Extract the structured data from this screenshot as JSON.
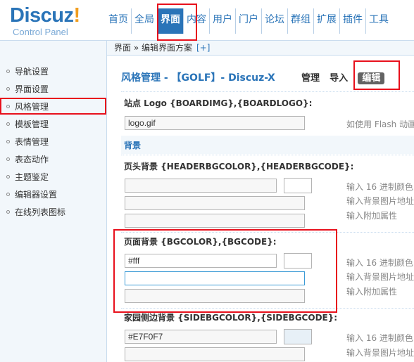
{
  "logo": {
    "main": "Discuz",
    "bang": "!",
    "sub": "Control Panel"
  },
  "nav": [
    {
      "label": "首页"
    },
    {
      "label": "全局"
    },
    {
      "label": "界面",
      "active": true
    },
    {
      "label": "内容"
    },
    {
      "label": "用户"
    },
    {
      "label": "门户"
    },
    {
      "label": "论坛"
    },
    {
      "label": "群组"
    },
    {
      "label": "扩展"
    },
    {
      "label": "插件"
    },
    {
      "label": "工具"
    }
  ],
  "breadcrumb": {
    "text": "界面 » 编辑界面方案",
    "plus": "[+]"
  },
  "sidebar": [
    {
      "label": "导航设置"
    },
    {
      "label": "界面设置"
    },
    {
      "label": "风格管理",
      "active": true
    },
    {
      "label": "模板管理"
    },
    {
      "label": "表情管理"
    },
    {
      "label": "表态动作"
    },
    {
      "label": "主题鉴定"
    },
    {
      "label": "编辑器设置"
    },
    {
      "label": "在线列表图标"
    }
  ],
  "main": {
    "title": "风格管理 - 【GOLF】- Discuz-X",
    "actions": [
      {
        "label": "管理"
      },
      {
        "label": "导入"
      },
      {
        "label": "编辑",
        "active": true
      }
    ],
    "logo_label": "站点 Logo {BOARDIMG},{BOARDLOGO}:",
    "logo_value": "logo.gif",
    "logo_hint": "如使用 Flash 动画",
    "section_bg": "背景",
    "header_bg_label": "页头背景 {HEADERBGCOLOR},{HEADERBGCODE}:",
    "page_bg_label": "页面背景 {BGCOLOR},{BGCODE}:",
    "page_bg_value": "#fff",
    "side_bg_label": "家园侧边背景 {SIDEBGCOLOR},{SIDEBGCODE}:",
    "side_bg_value": "#E7F0F7",
    "hint_color": "输入 16 进制颜色",
    "hint_image": "输入背景图片地址",
    "hint_extra": "输入附加属性"
  },
  "colors": {
    "brand": "#2a74b8",
    "accent": "#f19e20",
    "highlight": "#e8101c",
    "side_swatch": "#E7F0F7"
  }
}
